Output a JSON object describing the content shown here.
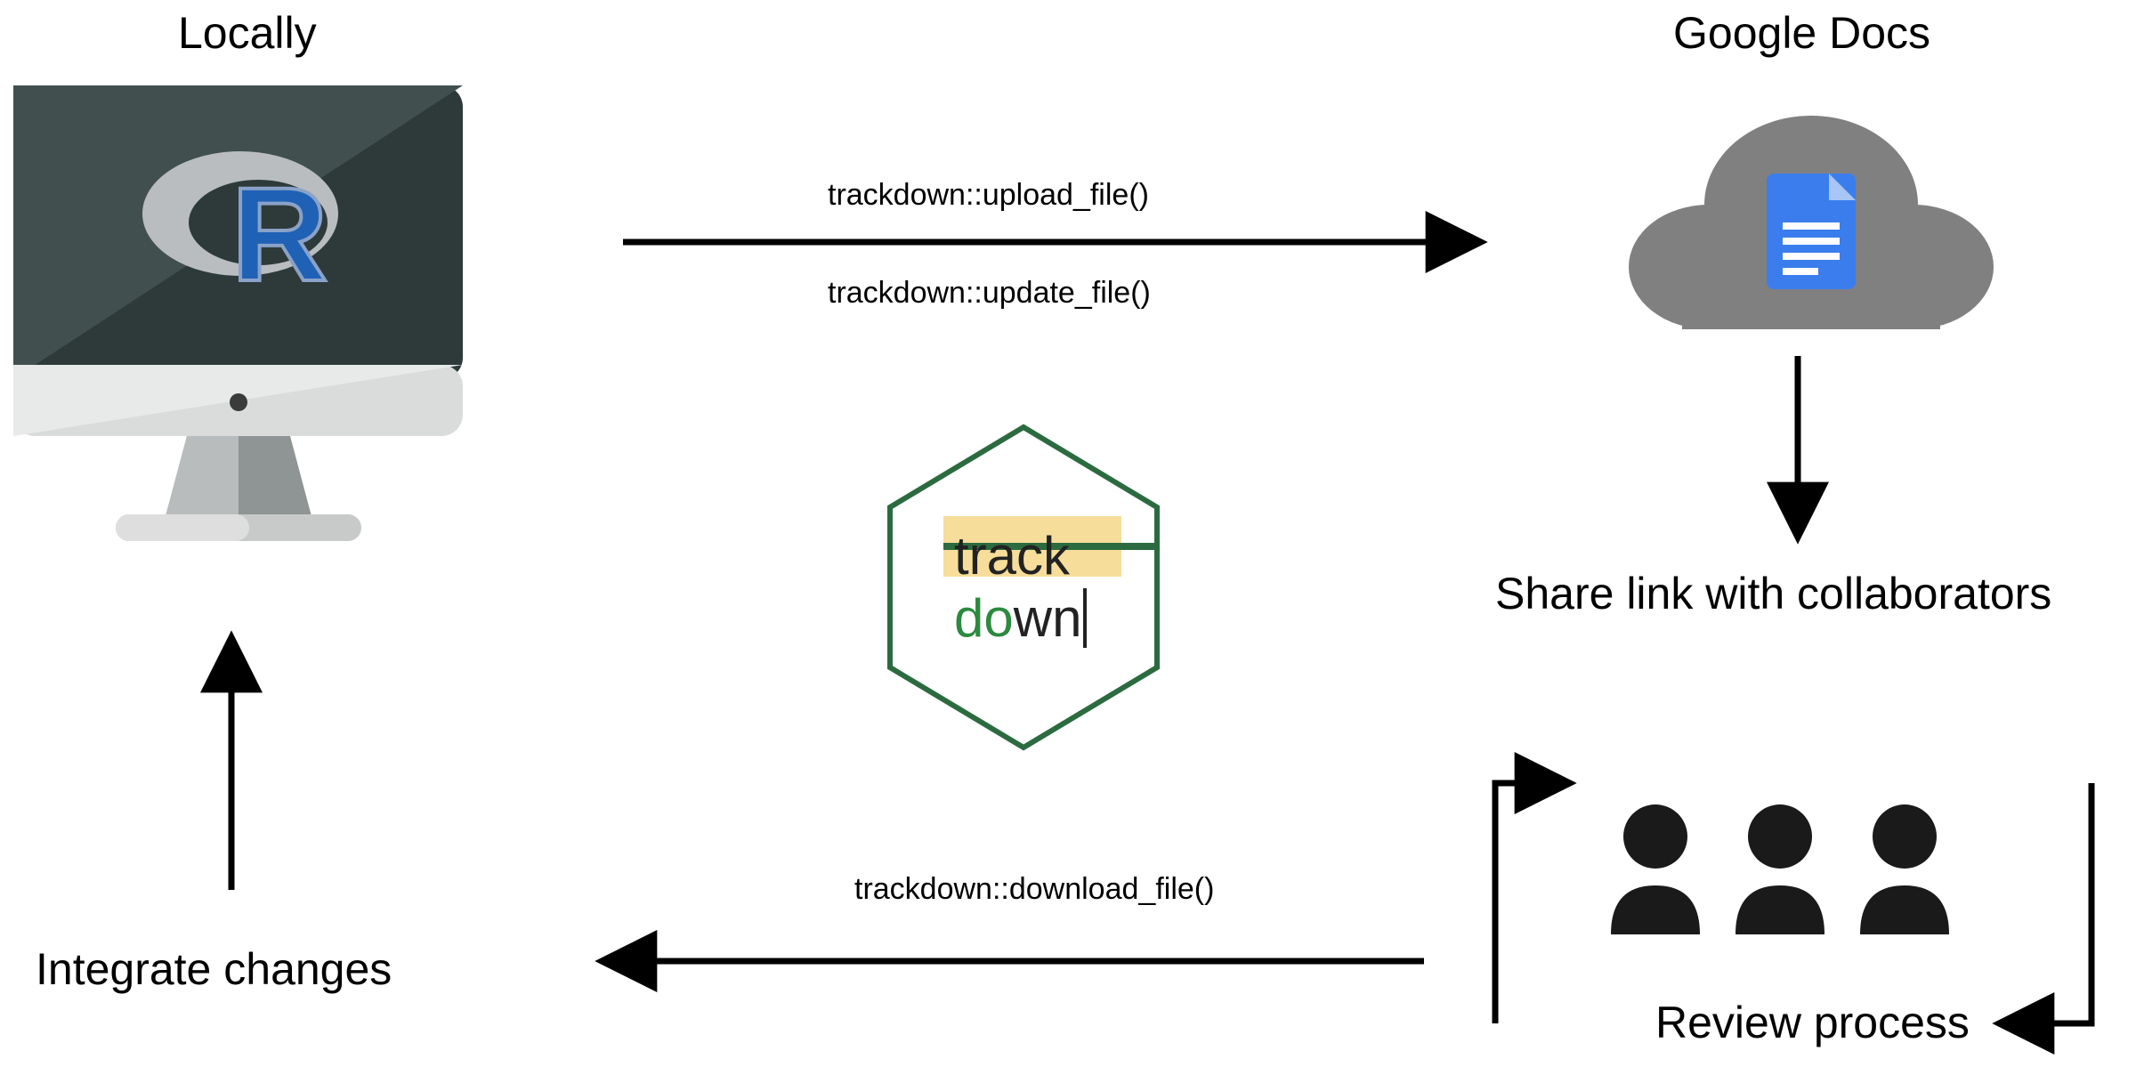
{
  "labels": {
    "locally": "Locally",
    "gdocs": "Google Docs",
    "share": "Share link with collaborators",
    "review": "Review process",
    "integrate": "Integrate changes",
    "upload": "trackdown::upload_file()",
    "update": "trackdown::update_file()",
    "download": "trackdown::download_file()",
    "hex_top": "track",
    "hex_bottom_a": "do",
    "hex_bottom_b": "wn"
  },
  "diagram": {
    "type": "workflow",
    "nodes": [
      {
        "id": "local",
        "label": "Locally",
        "icon": "computer-r"
      },
      {
        "id": "gdocs",
        "label": "Google Docs",
        "icon": "cloud-doc"
      },
      {
        "id": "share",
        "label": "Share link with collaborators"
      },
      {
        "id": "review",
        "label": "Review process",
        "icon": "collaborators"
      },
      {
        "id": "integrate",
        "label": "Integrate changes"
      },
      {
        "id": "package",
        "label": "trackdown",
        "icon": "hex-sticker"
      }
    ],
    "edges": [
      {
        "from": "local",
        "to": "gdocs",
        "labels": [
          "trackdown::upload_file()",
          "trackdown::update_file()"
        ]
      },
      {
        "from": "gdocs",
        "to": "share"
      },
      {
        "from": "share",
        "to": "review",
        "loop": true
      },
      {
        "from": "review",
        "to": "integrate",
        "labels": [
          "trackdown::download_file()"
        ]
      },
      {
        "from": "integrate",
        "to": "local"
      }
    ]
  }
}
